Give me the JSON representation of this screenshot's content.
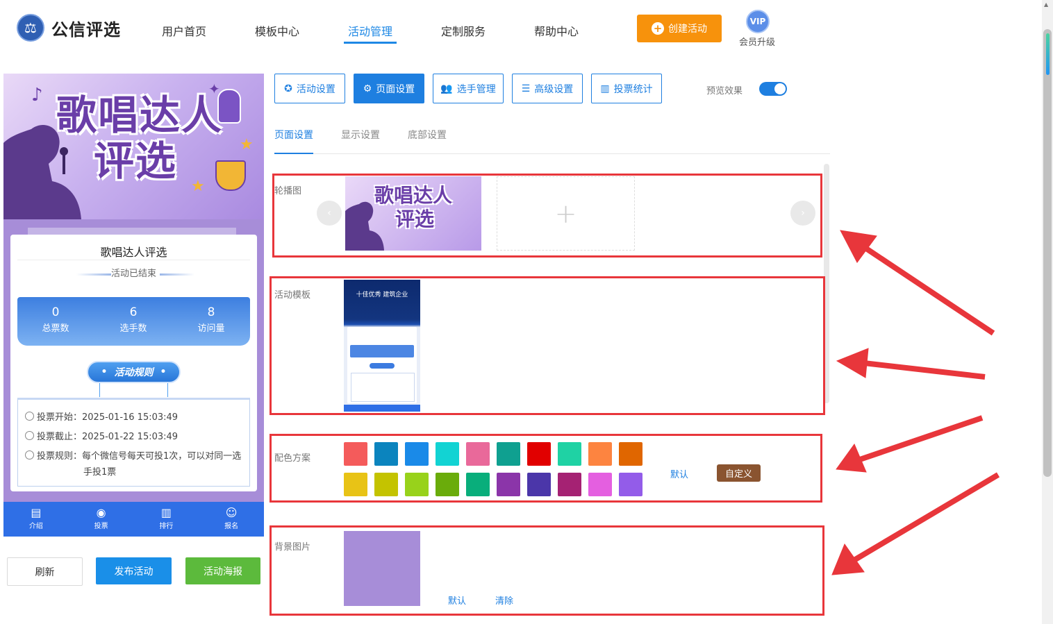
{
  "brand": {
    "name": "公信评选"
  },
  "nav": {
    "items": [
      "用户首页",
      "模板中心",
      "活动管理",
      "定制服务",
      "帮助中心"
    ],
    "active_index": 2
  },
  "header": {
    "create_label": "创建活动",
    "vip_text": "VIP",
    "vip_label": "会员升级"
  },
  "preview": {
    "banner_title_line1": "歌唱达人",
    "banner_title_line2": "评选",
    "activity_title": "歌唱达人评选",
    "status": "活动已结束",
    "stats": [
      {
        "value": "0",
        "label": "总票数"
      },
      {
        "value": "6",
        "label": "选手数"
      },
      {
        "value": "8",
        "label": "访问量"
      }
    ],
    "rules_button": "活动规则",
    "rules": {
      "start": "投票开始：2025-01-16 15:03:49",
      "end": "投票截止：2025-01-22 15:03:49",
      "rule_line1": "投票规则：每个微信号每天可投1次，可以对同一选",
      "rule_line2": "手投1票"
    },
    "tabbar": [
      {
        "label": "介绍",
        "icon": "document-icon"
      },
      {
        "label": "投票",
        "icon": "vote-icon"
      },
      {
        "label": "排行",
        "icon": "chart-icon"
      },
      {
        "label": "报名",
        "icon": "user-icon"
      }
    ]
  },
  "actions": {
    "refresh": "刷新",
    "publish": "发布活动",
    "poster": "活动海报"
  },
  "toolbar": {
    "buttons": [
      {
        "label": "活动设置",
        "icon": "star-icon"
      },
      {
        "label": "页面设置",
        "icon": "gear-icon"
      },
      {
        "label": "选手管理",
        "icon": "users-icon"
      },
      {
        "label": "高级设置",
        "icon": "settings-list-icon"
      },
      {
        "label": "投票统计",
        "icon": "bar-chart-icon"
      }
    ],
    "active_index": 1,
    "preview_label": "预览效果",
    "preview_on": true
  },
  "subtabs": {
    "items": [
      "页面设置",
      "显示设置",
      "底部设置"
    ],
    "active_index": 0
  },
  "sections": {
    "carousel_label": "轮播图",
    "carousel_image_line1": "歌唱达人",
    "carousel_image_line2": "评选",
    "template_label": "活动模板",
    "template_title": "十佳优秀 建筑企业",
    "color_label": "配色方案",
    "colors_row1": [
      "#f45b5b",
      "#0b84be",
      "#1a8ae8",
      "#12d3d3",
      "#e9699a",
      "#0fa090",
      "#e10000",
      "#1fd2a4",
      "#fd8440",
      "#e06600"
    ],
    "colors_row2": [
      "#e8c316",
      "#c4c300",
      "#98d21b",
      "#6aac0b",
      "#09ae7b",
      "#8b35a9",
      "#4b36a9",
      "#a52273",
      "#e45fe0",
      "#935ce9"
    ],
    "color_default": "默认",
    "color_custom": "自定义",
    "bg_label": "背景图片",
    "bg_color": "#a78dd8",
    "bg_default": "默认",
    "bg_clear": "清除"
  },
  "colors": {
    "accent": "#1e7fe0",
    "orange": "#f7920c",
    "annotation_red": "#e8363b"
  }
}
